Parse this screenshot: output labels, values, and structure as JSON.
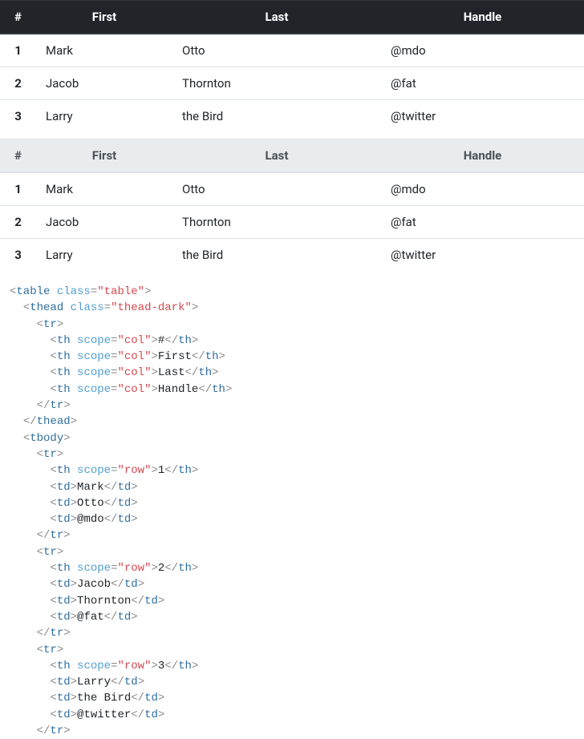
{
  "table1": {
    "theadClass": "dark",
    "headers": [
      "#",
      "First",
      "Last",
      "Handle"
    ],
    "rows": [
      {
        "num": "1",
        "first": "Mark",
        "last": "Otto",
        "handle": "@mdo"
      },
      {
        "num": "2",
        "first": "Jacob",
        "last": "Thornton",
        "handle": "@fat"
      },
      {
        "num": "3",
        "first": "Larry",
        "last": "the Bird",
        "handle": "@twitter"
      }
    ]
  },
  "table2": {
    "theadClass": "light",
    "headers": [
      "#",
      "First",
      "Last",
      "Handle"
    ],
    "rows": [
      {
        "num": "1",
        "first": "Mark",
        "last": "Otto",
        "handle": "@mdo"
      },
      {
        "num": "2",
        "first": "Jacob",
        "last": "Thornton",
        "handle": "@fat"
      },
      {
        "num": "3",
        "first": "Larry",
        "last": "the Bird",
        "handle": "@twitter"
      }
    ]
  },
  "code": {
    "lines": [
      [
        [
          "punct",
          "<"
        ],
        [
          "tag",
          "table"
        ],
        [
          "text",
          " "
        ],
        [
          "attr",
          "class"
        ],
        [
          "punct",
          "="
        ],
        [
          "val",
          "\"table\""
        ],
        [
          "punct",
          ">"
        ]
      ],
      [
        [
          "text",
          "  "
        ],
        [
          "punct",
          "<"
        ],
        [
          "tag",
          "thead"
        ],
        [
          "text",
          " "
        ],
        [
          "attr",
          "class"
        ],
        [
          "punct",
          "="
        ],
        [
          "val",
          "\"thead-dark\""
        ],
        [
          "punct",
          ">"
        ]
      ],
      [
        [
          "text",
          "    "
        ],
        [
          "punct",
          "<"
        ],
        [
          "tag",
          "tr"
        ],
        [
          "punct",
          ">"
        ]
      ],
      [
        [
          "text",
          "      "
        ],
        [
          "punct",
          "<"
        ],
        [
          "tag",
          "th"
        ],
        [
          "text",
          " "
        ],
        [
          "attr",
          "scope"
        ],
        [
          "punct",
          "="
        ],
        [
          "val",
          "\"col\""
        ],
        [
          "punct",
          ">"
        ],
        [
          "text",
          "#"
        ],
        [
          "punct",
          "</"
        ],
        [
          "tag",
          "th"
        ],
        [
          "punct",
          ">"
        ]
      ],
      [
        [
          "text",
          "      "
        ],
        [
          "punct",
          "<"
        ],
        [
          "tag",
          "th"
        ],
        [
          "text",
          " "
        ],
        [
          "attr",
          "scope"
        ],
        [
          "punct",
          "="
        ],
        [
          "val",
          "\"col\""
        ],
        [
          "punct",
          ">"
        ],
        [
          "text",
          "First"
        ],
        [
          "punct",
          "</"
        ],
        [
          "tag",
          "th"
        ],
        [
          "punct",
          ">"
        ]
      ],
      [
        [
          "text",
          "      "
        ],
        [
          "punct",
          "<"
        ],
        [
          "tag",
          "th"
        ],
        [
          "text",
          " "
        ],
        [
          "attr",
          "scope"
        ],
        [
          "punct",
          "="
        ],
        [
          "val",
          "\"col\""
        ],
        [
          "punct",
          ">"
        ],
        [
          "text",
          "Last"
        ],
        [
          "punct",
          "</"
        ],
        [
          "tag",
          "th"
        ],
        [
          "punct",
          ">"
        ]
      ],
      [
        [
          "text",
          "      "
        ],
        [
          "punct",
          "<"
        ],
        [
          "tag",
          "th"
        ],
        [
          "text",
          " "
        ],
        [
          "attr",
          "scope"
        ],
        [
          "punct",
          "="
        ],
        [
          "val",
          "\"col\""
        ],
        [
          "punct",
          ">"
        ],
        [
          "text",
          "Handle"
        ],
        [
          "punct",
          "</"
        ],
        [
          "tag",
          "th"
        ],
        [
          "punct",
          ">"
        ]
      ],
      [
        [
          "text",
          "    "
        ],
        [
          "punct",
          "</"
        ],
        [
          "tag",
          "tr"
        ],
        [
          "punct",
          ">"
        ]
      ],
      [
        [
          "text",
          "  "
        ],
        [
          "punct",
          "</"
        ],
        [
          "tag",
          "thead"
        ],
        [
          "punct",
          ">"
        ]
      ],
      [
        [
          "text",
          "  "
        ],
        [
          "punct",
          "<"
        ],
        [
          "tag",
          "tbody"
        ],
        [
          "punct",
          ">"
        ]
      ],
      [
        [
          "text",
          "    "
        ],
        [
          "punct",
          "<"
        ],
        [
          "tag",
          "tr"
        ],
        [
          "punct",
          ">"
        ]
      ],
      [
        [
          "text",
          "      "
        ],
        [
          "punct",
          "<"
        ],
        [
          "tag",
          "th"
        ],
        [
          "text",
          " "
        ],
        [
          "attr",
          "scope"
        ],
        [
          "punct",
          "="
        ],
        [
          "val",
          "\"row\""
        ],
        [
          "punct",
          ">"
        ],
        [
          "text",
          "1"
        ],
        [
          "punct",
          "</"
        ],
        [
          "tag",
          "th"
        ],
        [
          "punct",
          ">"
        ]
      ],
      [
        [
          "text",
          "      "
        ],
        [
          "punct",
          "<"
        ],
        [
          "tag",
          "td"
        ],
        [
          "punct",
          ">"
        ],
        [
          "text",
          "Mark"
        ],
        [
          "punct",
          "</"
        ],
        [
          "tag",
          "td"
        ],
        [
          "punct",
          ">"
        ]
      ],
      [
        [
          "text",
          "      "
        ],
        [
          "punct",
          "<"
        ],
        [
          "tag",
          "td"
        ],
        [
          "punct",
          ">"
        ],
        [
          "text",
          "Otto"
        ],
        [
          "punct",
          "</"
        ],
        [
          "tag",
          "td"
        ],
        [
          "punct",
          ">"
        ]
      ],
      [
        [
          "text",
          "      "
        ],
        [
          "punct",
          "<"
        ],
        [
          "tag",
          "td"
        ],
        [
          "punct",
          ">"
        ],
        [
          "text",
          "@mdo"
        ],
        [
          "punct",
          "</"
        ],
        [
          "tag",
          "td"
        ],
        [
          "punct",
          ">"
        ]
      ],
      [
        [
          "text",
          "    "
        ],
        [
          "punct",
          "</"
        ],
        [
          "tag",
          "tr"
        ],
        [
          "punct",
          ">"
        ]
      ],
      [
        [
          "text",
          "    "
        ],
        [
          "punct",
          "<"
        ],
        [
          "tag",
          "tr"
        ],
        [
          "punct",
          ">"
        ]
      ],
      [
        [
          "text",
          "      "
        ],
        [
          "punct",
          "<"
        ],
        [
          "tag",
          "th"
        ],
        [
          "text",
          " "
        ],
        [
          "attr",
          "scope"
        ],
        [
          "punct",
          "="
        ],
        [
          "val",
          "\"row\""
        ],
        [
          "punct",
          ">"
        ],
        [
          "text",
          "2"
        ],
        [
          "punct",
          "</"
        ],
        [
          "tag",
          "th"
        ],
        [
          "punct",
          ">"
        ]
      ],
      [
        [
          "text",
          "      "
        ],
        [
          "punct",
          "<"
        ],
        [
          "tag",
          "td"
        ],
        [
          "punct",
          ">"
        ],
        [
          "text",
          "Jacob"
        ],
        [
          "punct",
          "</"
        ],
        [
          "tag",
          "td"
        ],
        [
          "punct",
          ">"
        ]
      ],
      [
        [
          "text",
          "      "
        ],
        [
          "punct",
          "<"
        ],
        [
          "tag",
          "td"
        ],
        [
          "punct",
          ">"
        ],
        [
          "text",
          "Thornton"
        ],
        [
          "punct",
          "</"
        ],
        [
          "tag",
          "td"
        ],
        [
          "punct",
          ">"
        ]
      ],
      [
        [
          "text",
          "      "
        ],
        [
          "punct",
          "<"
        ],
        [
          "tag",
          "td"
        ],
        [
          "punct",
          ">"
        ],
        [
          "text",
          "@fat"
        ],
        [
          "punct",
          "</"
        ],
        [
          "tag",
          "td"
        ],
        [
          "punct",
          ">"
        ]
      ],
      [
        [
          "text",
          "    "
        ],
        [
          "punct",
          "</"
        ],
        [
          "tag",
          "tr"
        ],
        [
          "punct",
          ">"
        ]
      ],
      [
        [
          "text",
          "    "
        ],
        [
          "punct",
          "<"
        ],
        [
          "tag",
          "tr"
        ],
        [
          "punct",
          ">"
        ]
      ],
      [
        [
          "text",
          "      "
        ],
        [
          "punct",
          "<"
        ],
        [
          "tag",
          "th"
        ],
        [
          "text",
          " "
        ],
        [
          "attr",
          "scope"
        ],
        [
          "punct",
          "="
        ],
        [
          "val",
          "\"row\""
        ],
        [
          "punct",
          ">"
        ],
        [
          "text",
          "3"
        ],
        [
          "punct",
          "</"
        ],
        [
          "tag",
          "th"
        ],
        [
          "punct",
          ">"
        ]
      ],
      [
        [
          "text",
          "      "
        ],
        [
          "punct",
          "<"
        ],
        [
          "tag",
          "td"
        ],
        [
          "punct",
          ">"
        ],
        [
          "text",
          "Larry"
        ],
        [
          "punct",
          "</"
        ],
        [
          "tag",
          "td"
        ],
        [
          "punct",
          ">"
        ]
      ],
      [
        [
          "text",
          "      "
        ],
        [
          "punct",
          "<"
        ],
        [
          "tag",
          "td"
        ],
        [
          "punct",
          ">"
        ],
        [
          "text",
          "the Bird"
        ],
        [
          "punct",
          "</"
        ],
        [
          "tag",
          "td"
        ],
        [
          "punct",
          ">"
        ]
      ],
      [
        [
          "text",
          "      "
        ],
        [
          "punct",
          "<"
        ],
        [
          "tag",
          "td"
        ],
        [
          "punct",
          ">"
        ],
        [
          "text",
          "@twitter"
        ],
        [
          "punct",
          "</"
        ],
        [
          "tag",
          "td"
        ],
        [
          "punct",
          ">"
        ]
      ],
      [
        [
          "text",
          "    "
        ],
        [
          "punct",
          "</"
        ],
        [
          "tag",
          "tr"
        ],
        [
          "punct",
          ">"
        ]
      ]
    ]
  }
}
